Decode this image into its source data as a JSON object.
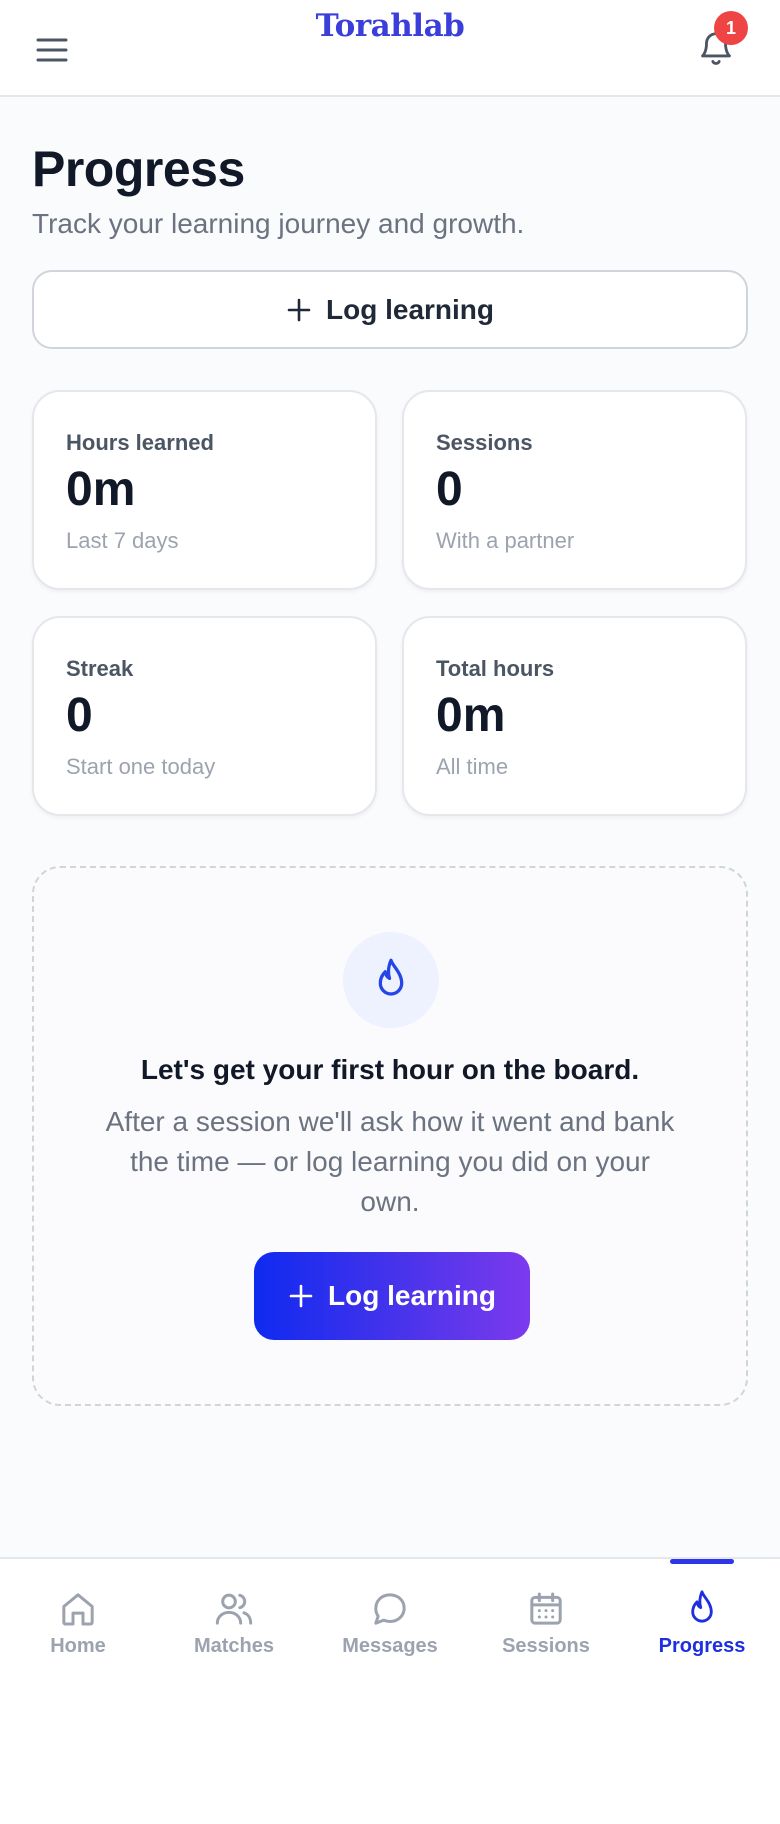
{
  "header": {
    "brand": "Torahlab",
    "notification_count": "1",
    "menu_icon": "hamburger-icon",
    "bell_icon": "bell-icon"
  },
  "page": {
    "title": "Progress",
    "subtitle": "Track your learning journey and growth.",
    "log_button_label": "Log learning"
  },
  "stats": [
    {
      "label": "Hours learned",
      "value": "0m",
      "sub": "Last 7 days"
    },
    {
      "label": "Sessions",
      "value": "0",
      "sub": "With a partner"
    },
    {
      "label": "Streak",
      "value": "0",
      "sub": "Start one today"
    },
    {
      "label": "Total hours",
      "value": "0m",
      "sub": "All time"
    }
  ],
  "empty_state": {
    "icon": "flame-icon",
    "title": "Let's get your first hour on the board.",
    "text": "After a session we'll ask how it went and bank the time — or log learning you did on your own.",
    "button_label": "Log learning"
  },
  "bottom_nav": {
    "items": [
      {
        "label": "Home",
        "icon": "home-icon",
        "active": false
      },
      {
        "label": "Matches",
        "icon": "users-icon",
        "active": false
      },
      {
        "label": "Messages",
        "icon": "chat-bubble-icon",
        "active": false
      },
      {
        "label": "Sessions",
        "icon": "calendar-icon",
        "active": false
      },
      {
        "label": "Progress",
        "icon": "flame-icon",
        "active": true
      }
    ]
  },
  "colors": {
    "brand": "#3b3fd9",
    "accent": "#1d2fe0",
    "badge": "#ef4444",
    "gradient_start": "#0f2af0",
    "gradient_end": "#7c3aed"
  }
}
